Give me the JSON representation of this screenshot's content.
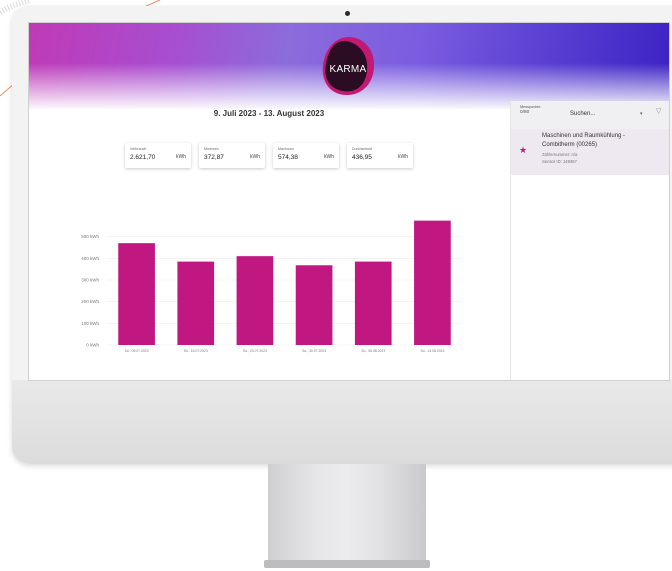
{
  "app": {
    "logo_text": "KARMA"
  },
  "dashboard": {
    "date_range": "9. Juli 2023 - 13. August 2023",
    "stats": [
      {
        "label": "Verbrauch",
        "value": "2.621,70",
        "unit": "kWh"
      },
      {
        "label": "Minimum",
        "value": "372,87",
        "unit": "kWh"
      },
      {
        "label": "Maximum",
        "value": "574,38",
        "unit": "kWh"
      },
      {
        "label": "Durchschnitt",
        "value": "436,95",
        "unit": "kWh"
      }
    ]
  },
  "sidebar": {
    "count_label": "Messpunkte",
    "count_value": "0/80",
    "search_placeholder": "Suchen...",
    "item": {
      "name_line1": "Maschinen und Raumkühlung -",
      "name_line2": "Combitherm (00265)",
      "meter": "Zählernummer: n/a",
      "sensor": "Sensor ID: 149357"
    }
  },
  "colors": {
    "bar": "#c01880",
    "accent": "#7a4de0"
  },
  "chart_data": {
    "type": "bar",
    "categories": [
      "So., 09.07.2023",
      "So., 16.07.2023",
      "So., 23.07.2023",
      "So., 30.07.2023",
      "So., 06.08.2023",
      "So., 13.08.2023"
    ],
    "values": [
      470,
      385,
      410,
      368,
      385,
      574
    ],
    "ylim": [
      0,
      500
    ],
    "yticks": [
      "0 kWh",
      "100 kWh",
      "200 kWh",
      "300 kWh",
      "400 kWh",
      "500 kWh"
    ],
    "grid": true
  }
}
